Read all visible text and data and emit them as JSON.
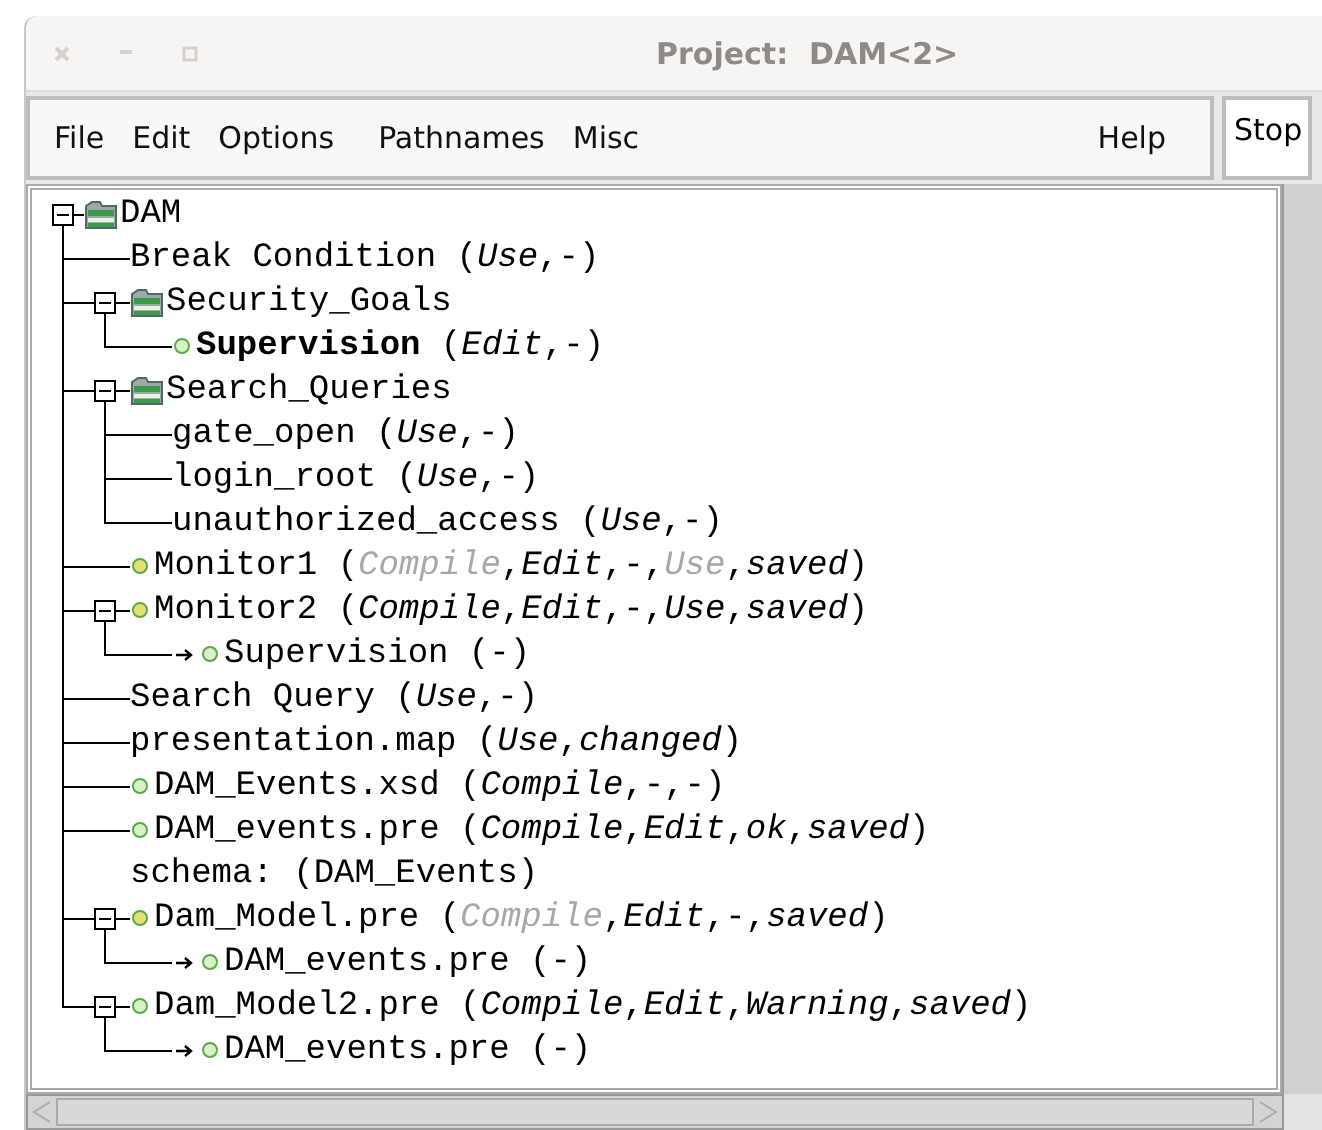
{
  "window": {
    "title": "Project:  DAM<2>"
  },
  "menu_left": [
    "File",
    "Edit",
    "Options",
    "Pathnames",
    "Misc"
  ],
  "menu_right": [
    "Help"
  ],
  "stop_field": {
    "value": "Stop"
  },
  "tree": [
    {
      "kind": "folder",
      "expanded": true,
      "label": [
        {
          "text": "DAM"
        }
      ],
      "children": [
        {
          "kind": "plain",
          "label": [
            {
              "text": "Break Condition ("
            },
            {
              "text": "Use",
              "kind": "italic"
            },
            {
              "text": ",-)"
            }
          ]
        },
        {
          "kind": "folder",
          "expanded": true,
          "label": [
            {
              "text": "Security_Goals"
            }
          ],
          "children": [
            {
              "kind": "dot",
              "color": "#d8f0c8",
              "label": [
                {
                  "text": "Supervision",
                  "kind": "bold"
                },
                {
                  "text": " ("
                },
                {
                  "text": "Edit",
                  "kind": "italic"
                },
                {
                  "text": ",-)"
                }
              ]
            }
          ]
        },
        {
          "kind": "folder",
          "expanded": true,
          "label": [
            {
              "text": "Search_Queries"
            }
          ],
          "children": [
            {
              "kind": "plain",
              "label": [
                {
                  "text": "gate_open ("
                },
                {
                  "text": "Use",
                  "kind": "italic"
                },
                {
                  "text": ",-)"
                }
              ]
            },
            {
              "kind": "plain",
              "label": [
                {
                  "text": "login_root ("
                },
                {
                  "text": "Use",
                  "kind": "italic"
                },
                {
                  "text": ",-)"
                }
              ]
            },
            {
              "kind": "plain",
              "label": [
                {
                  "text": "unauthorized_access ("
                },
                {
                  "text": "Use",
                  "kind": "italic"
                },
                {
                  "text": ",-)"
                }
              ]
            }
          ]
        },
        {
          "kind": "dot",
          "color": "#e6e070",
          "label": [
            {
              "text": "Monitor1 ("
            },
            {
              "text": "Compile",
              "kind": "dim"
            },
            {
              "text": ","
            },
            {
              "text": "Edit",
              "kind": "italic"
            },
            {
              "text": ",-,"
            },
            {
              "text": "Use",
              "kind": "dim"
            },
            {
              "text": ","
            },
            {
              "text": "saved",
              "kind": "italic"
            },
            {
              "text": ")"
            }
          ]
        },
        {
          "kind": "dot",
          "color": "#e6e070",
          "expanded": true,
          "label": [
            {
              "text": "Monitor2 ("
            },
            {
              "text": "Compile",
              "kind": "italic"
            },
            {
              "text": ","
            },
            {
              "text": "Edit",
              "kind": "italic"
            },
            {
              "text": ",-,"
            },
            {
              "text": "Use",
              "kind": "italic"
            },
            {
              "text": ","
            },
            {
              "text": "saved",
              "kind": "italic"
            },
            {
              "text": ")"
            }
          ],
          "children": [
            {
              "kind": "dot",
              "link": true,
              "color": "#d8f0c8",
              "label": [
                {
                  "text": "Supervision (-)"
                }
              ]
            }
          ]
        },
        {
          "kind": "plain",
          "label": [
            {
              "text": "Search Query ("
            },
            {
              "text": "Use",
              "kind": "italic"
            },
            {
              "text": ",-)"
            }
          ]
        },
        {
          "kind": "plain",
          "label": [
            {
              "text": "presentation.map ("
            },
            {
              "text": "Use",
              "kind": "italic"
            },
            {
              "text": ","
            },
            {
              "text": "changed",
              "kind": "italic"
            },
            {
              "text": ")"
            }
          ]
        },
        {
          "kind": "dot",
          "color": "#d8f0c8",
          "label": [
            {
              "text": "DAM_Events.xsd ("
            },
            {
              "text": "Compile",
              "kind": "italic"
            },
            {
              "text": ",-,-)"
            }
          ]
        },
        {
          "kind": "dot",
          "color": "#d8f0c8",
          "label": [
            {
              "text": "DAM_events.pre ("
            },
            {
              "text": "Compile",
              "kind": "italic"
            },
            {
              "text": ","
            },
            {
              "text": "Edit",
              "kind": "italic"
            },
            {
              "text": ","
            },
            {
              "text": "ok",
              "kind": "italic"
            },
            {
              "text": ","
            },
            {
              "text": "saved",
              "kind": "italic"
            },
            {
              "text": ")"
            }
          ],
          "detail": "schema: (DAM_Events)"
        },
        {
          "kind": "dot",
          "color": "#e6e070",
          "expanded": true,
          "label": [
            {
              "text": "Dam_Model.pre ("
            },
            {
              "text": "Compile",
              "kind": "dim"
            },
            {
              "text": ","
            },
            {
              "text": "Edit",
              "kind": "italic"
            },
            {
              "text": ",-,"
            },
            {
              "text": "saved",
              "kind": "italic"
            },
            {
              "text": ")"
            }
          ],
          "children": [
            {
              "kind": "dot",
              "link": true,
              "color": "#d8f0c8",
              "label": [
                {
                  "text": "DAM_events.pre (-)"
                }
              ]
            }
          ]
        },
        {
          "kind": "dot",
          "color": "#d8f0c8",
          "expanded": true,
          "label": [
            {
              "text": "Dam_Model2.pre ("
            },
            {
              "text": "Compile",
              "kind": "italic"
            },
            {
              "text": ","
            },
            {
              "text": "Edit",
              "kind": "italic"
            },
            {
              "text": ","
            },
            {
              "text": "Warning",
              "kind": "italic"
            },
            {
              "text": ","
            },
            {
              "text": "saved",
              "kind": "italic"
            },
            {
              "text": ")"
            }
          ],
          "children": [
            {
              "kind": "dot",
              "link": true,
              "color": "#d8f0c8",
              "label": [
                {
                  "text": "DAM_events.pre (-)"
                }
              ]
            }
          ]
        }
      ]
    }
  ]
}
